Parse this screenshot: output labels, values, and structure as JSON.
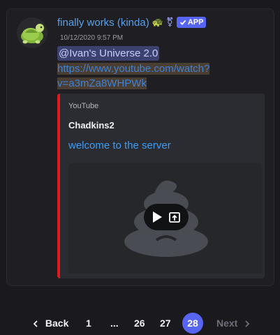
{
  "message": {
    "username": "finally works (kinda)",
    "turtle_emoji": "🐢",
    "trans_symbol": "⚧",
    "app_badge": "APP",
    "timestamp": "10/12/2020 9:57 PM",
    "mention": "@Ivan's Universe 2.0",
    "link": {
      "line1": "https://www.youtube.com/watch?",
      "line2": "v=a3mZa8WHPWk"
    }
  },
  "embed": {
    "provider": "YouTube",
    "author": "Chadkins2",
    "title": "welcome to the server",
    "accent_color": "#e01b1b"
  },
  "pagination": {
    "back_label": "Back",
    "next_label": "Next",
    "pages": [
      "1",
      "...",
      "26",
      "27",
      "28"
    ],
    "current": "28"
  }
}
